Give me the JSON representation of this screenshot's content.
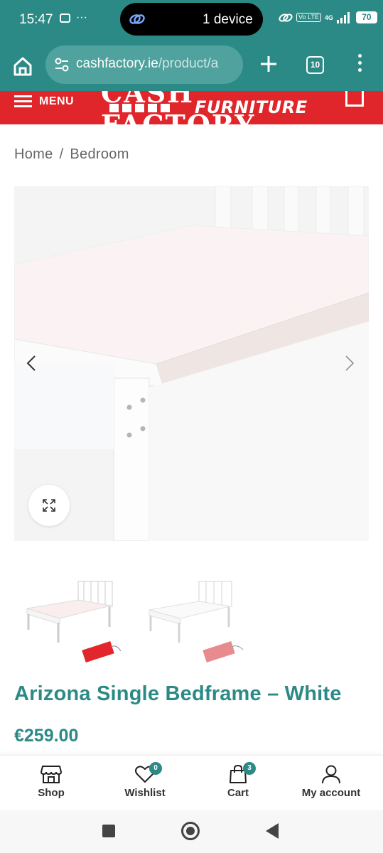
{
  "status_bar": {
    "time": "15:47",
    "device_pill": "1 device",
    "network": "4G",
    "volte": "Vo LTE",
    "battery": "70"
  },
  "browser": {
    "url_main": "cashfactory.ie",
    "url_path": "/product/a",
    "tab_count": "10"
  },
  "header": {
    "menu_label": "MENU",
    "logo_top": "CASH FACTORY",
    "logo_bottom": "FURNITURE",
    "brand_color": "#e0262b"
  },
  "breadcrumb": {
    "home": "Home",
    "separator": "/",
    "category": "Bedroom"
  },
  "product": {
    "title": "Arizona Single Bedframe – White",
    "price": "€259.00",
    "accent_color": "#2c8a86"
  },
  "bottom_nav": {
    "shop": "Shop",
    "wishlist": "Wishlist",
    "wishlist_count": "0",
    "cart": "Cart",
    "cart_count": "3",
    "account": "My account"
  },
  "icons": {
    "home": "home-icon",
    "tune": "site-settings-icon",
    "plus": "new-tab-icon",
    "tabs": "tab-switcher-icon",
    "more": "more-vert-icon",
    "menu": "hamburger-icon",
    "cart_header": "shopping-bag-icon",
    "prev": "chevron-left-icon",
    "next": "chevron-right-icon",
    "zoom": "fullscreen-icon",
    "shop": "store-icon",
    "wishlist": "heart-icon",
    "cart": "cart-bag-icon",
    "account": "user-icon"
  }
}
